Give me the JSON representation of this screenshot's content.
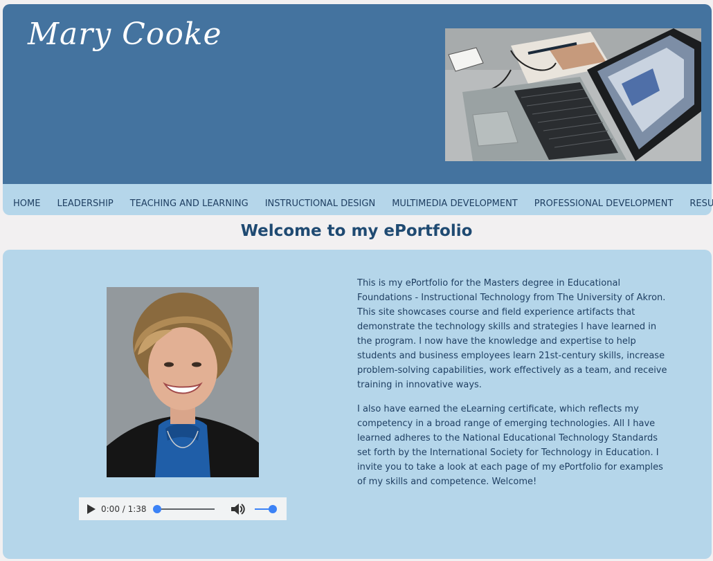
{
  "header": {
    "site_title": "Mary Cooke"
  },
  "nav": {
    "items": [
      "HOME",
      "LEADERSHIP",
      "TEACHING AND LEARNING",
      "INSTRUCTIONAL DESIGN",
      "MULTIMEDIA DEVELOPMENT",
      "PROFESSIONAL DEVELOPMENT",
      "RESUME"
    ]
  },
  "main": {
    "page_title": "Welcome to my ePortfolio",
    "paragraphs": [
      "This is my ePortfolio for the Masters degree in Educational Foundations - Instructional Technology from The University of Akron. This site showcases course and field experience artifacts that demonstrate the technology skills and strategies I have learned in the program. I now have the knowledge and expertise to help students and business employees learn 21st-century skills, increase problem-solving capabilities, work effectively as a team, and receive training in innovative ways.",
      "I also have earned the eLearning certificate, which reflects my competency in a broad range of emerging technologies. All I have learned adheres to the National Educational Technology Standards set forth by the International Society for Technology in Education. I invite you to take a look at each page of my ePortfolio for examples of my skills and competence. Welcome!"
    ],
    "audio": {
      "time_display": "0:00 / 1:38",
      "progress": 0,
      "volume": 1
    }
  },
  "colors": {
    "header_bg": "#44739f",
    "nav_bg": "#b5d6ea",
    "page_bg": "#f2f0f1",
    "text": "#1f3f62",
    "accent": "#3b82f6"
  },
  "icons": {
    "play": "play-icon",
    "volume": "volume-icon"
  }
}
